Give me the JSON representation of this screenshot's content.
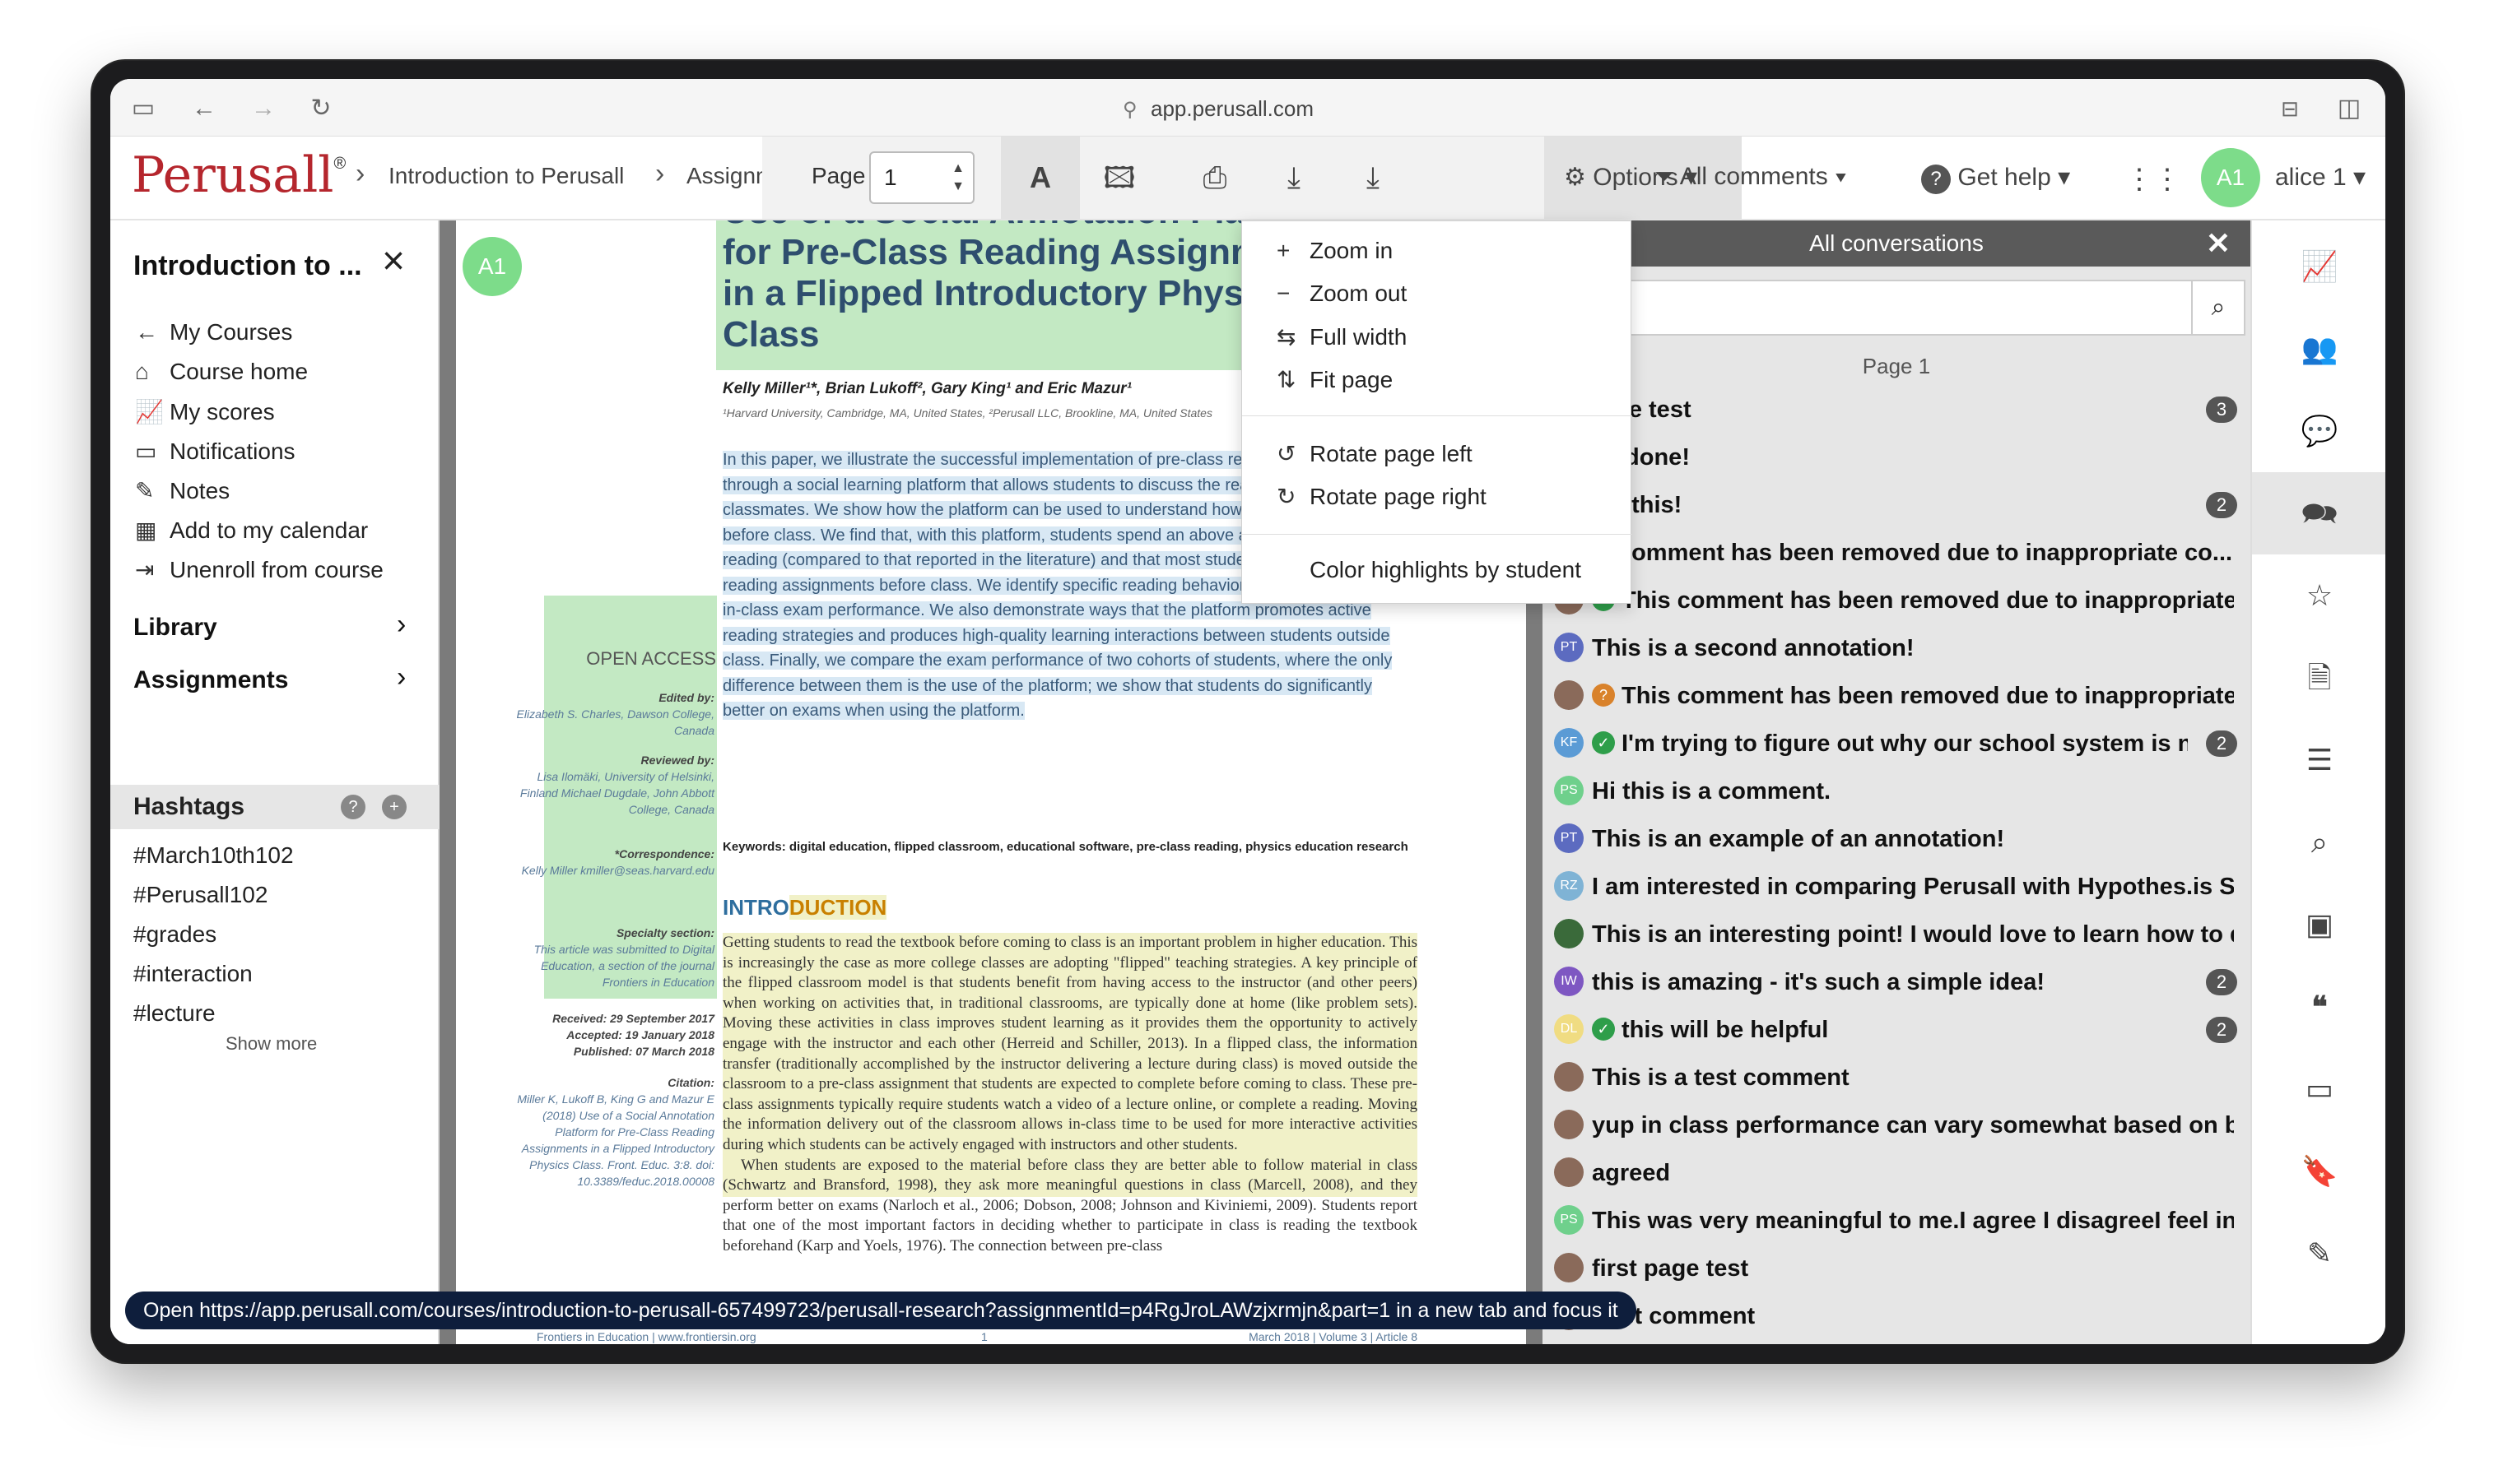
{
  "browser": {
    "url": "app.perusall.com"
  },
  "app": {
    "logo": "Perusall",
    "breadcrumb": [
      "Introduction to Perusall",
      "Assignm"
    ],
    "toolbar": {
      "page_label": "Page",
      "page_value": "1",
      "options_label": "Options ▾"
    },
    "all_comments_label": "All comments ▾",
    "get_help_label": "Get help ▾",
    "user_initials": "A1",
    "user_name": "alice 1 ▾"
  },
  "sidebar": {
    "title": "Introduction to ...",
    "items": [
      {
        "icon": "arrow-left-icon",
        "label": "My Courses"
      },
      {
        "icon": "home-icon",
        "label": "Course home"
      },
      {
        "icon": "chart-icon",
        "label": "My scores"
      },
      {
        "icon": "inbox-icon",
        "label": "Notifications"
      },
      {
        "icon": "pencil-icon",
        "label": "Notes"
      },
      {
        "icon": "calendar-icon",
        "label": "Add to my calendar"
      },
      {
        "icon": "exit-icon",
        "label": "Unenroll from course"
      }
    ],
    "library_label": "Library",
    "assignments_label": "Assignments",
    "hashtags_label": "Hashtags",
    "hashtags": [
      "#March10th102",
      "#Perusall102",
      "#grades",
      "#interaction",
      "#lecture"
    ],
    "show_more": "Show more"
  },
  "document": {
    "avatar": "A1",
    "title_lines": [
      "Use of a Social Annotation Platform",
      "for Pre-Class Reading Assignments",
      "in a Flipped Introductory Physics",
      "Class"
    ],
    "authors": "Kelly Miller¹*, Brian Lukoff², Gary King¹ and Eric Mazur¹",
    "affiliation": "¹Harvard University, Cambridge, MA, United States, ²Perusall LLC, Brookline, MA, United States",
    "abstract": "In this paper, we illustrate the successful implementation of pre-class reading assignments through a social learning platform that allows students to discuss the reading online with their classmates. We show how the platform can be used to understand how students are reading before class. We find that, with this platform, students spend an above average amount of time reading (compared to that reported in the literature) and that most students complete their reading assignments before class. We identify specific reading behaviors that are predictive of in-class exam performance. We also demonstrate ways that the platform promotes active reading strategies and produces high-quality learning interactions between students outside class. Finally, we compare the exam performance of two cohorts of students, where the only difference between them is the use of the platform; we show that students do significantly better on exams when using the platform.",
    "keywords": "Keywords: digital education, flipped classroom, educational software, pre-class reading, physics education research",
    "intro_heading_a": "INTRO",
    "intro_heading_b": "DUCTION",
    "body_p1": "Getting students to read the textbook before coming to class is an important problem in higher education. This is increasingly the case as more college classes are adopting \"flipped\" teaching strategies. A key principle of the flipped classroom model is that students benefit from having access to the instructor (and other peers) when working on activities that, in traditional classrooms, are typically done at home (like problem sets). Moving these activities in class improves student learning as it provides them the opportunity to actively engage with the instructor and each other (Herreid and Schiller, 2013). In a flipped class, the information transfer (traditionally accomplished by the instructor delivering a lecture during class) is moved outside the classroom to a pre-class assignment that students are expected to complete before coming to class. These pre-class assignments typically require students watch a video of a lecture online, or complete a reading. Moving the information delivery out of the classroom allows in-class time to be used for more interactive activities during which students can be actively engaged with instructors and other students.",
    "body_p2": "When students are exposed to the material before class they are better able to follow material in class (Schwartz and Bransford, 1998), they ask more meaningful questions in class (Marcell, 2008), and they perform better on exams (Narloch et al., 2006; Dobson, 2008; Johnson and Kiviniemi, 2009). Students report that one of the most important factors in deciding whether to participate in class is reading the textbook beforehand (Karp and Yoels, 1976). The connection between pre-class",
    "open_access": "OPEN ACCESS",
    "side": {
      "edited_by_label": "Edited by:",
      "edited_by": "Elizabeth S. Charles, Dawson College, Canada",
      "reviewed_by_label": "Reviewed by:",
      "reviewed_by": "Lisa Ilomäki, University of Helsinki, Finland Michael Dugdale, John Abbott College, Canada",
      "correspondence_label": "*Correspondence:",
      "correspondence": "Kelly Miller kmiller@seas.harvard.edu",
      "specialty_label": "Specialty section:",
      "specialty": "This article was submitted to Digital Education, a section of the journal Frontiers in Education",
      "received": "Received: 29 September 2017",
      "accepted": "Accepted: 19 January 2018",
      "published": "Published: 07 March 2018",
      "citation_label": "Citation:",
      "citation": "Miller K, Lukoff B, King G and Mazur E (2018) Use of a Social Annotation Platform for Pre-Class Reading Assignments in a Flipped Introductory Physics Class. Front. Educ. 3:8. doi: 10.3389/feduc.2018.00008"
    },
    "footer_left": "Frontiers in Education | www.frontiersin.org",
    "footer_center": "1",
    "footer_right": "March 2018 | Volume 3 | Article 8"
  },
  "options_menu": {
    "zoom_in": "Zoom in",
    "zoom_out": "Zoom out",
    "full_width": "Full width",
    "fit_page": "Fit page",
    "rotate_left": "Rotate page left",
    "rotate_right": "Rotate page right",
    "color_highlights": "Color highlights by student"
  },
  "conversations": {
    "header": "All conversations",
    "search_value": "h",
    "page_label": "Page 1",
    "items": [
      {
        "initials": "",
        "color": "#888888",
        "check": "",
        "text": "icture test",
        "count": "3"
      },
      {
        "initials": "",
        "color": "#888888",
        "check": "",
        "text": "Vell done!",
        "count": ""
      },
      {
        "initials": "",
        "color": "#888888",
        "check": "",
        "text": "love this!",
        "count": "2"
      },
      {
        "initials": "",
        "color": "#888888",
        "check": "",
        "text": "his comment has been removed due to inappropriate co...",
        "count": ""
      },
      {
        "initials": "",
        "color": "#8a6a5a",
        "check": "green",
        "text": "This comment has been removed due to inappropriate co...",
        "count": ""
      },
      {
        "initials": "PT",
        "color": "#5c6bc0",
        "check": "",
        "text": "This is a second annotation!",
        "count": ""
      },
      {
        "initials": "",
        "color": "#8a6a5a",
        "check": "orange",
        "text": "This comment has been removed due to inappropriate co...",
        "count": ""
      },
      {
        "initials": "KF",
        "color": "#5b9bd5",
        "check": "green",
        "text": "I'm trying to figure out why our school system is not us...",
        "count": "2"
      },
      {
        "initials": "PS",
        "color": "#6fd08c",
        "check": "",
        "text": "Hi this is a comment.",
        "count": ""
      },
      {
        "initials": "PT",
        "color": "#5c6bc0",
        "check": "",
        "text": "This is an example of an annotation!",
        "count": ""
      },
      {
        "initials": "RZ",
        "color": "#7fb3d5",
        "check": "",
        "text": "I am interested in comparing Perusall with Hypothes.is So fa...",
        "count": ""
      },
      {
        "initials": "",
        "color": "#3a6a3a",
        "check": "",
        "text": "This is an interesting point! I would love to learn how to do th...",
        "count": ""
      },
      {
        "initials": "IW",
        "color": "#7e57c2",
        "check": "",
        "text": "this is amazing - it's such a simple idea!",
        "count": "2"
      },
      {
        "initials": "DL",
        "color": "#f0dc82",
        "check": "green",
        "text": "this will be helpful",
        "count": "2"
      },
      {
        "initials": "",
        "color": "#8a6a5a",
        "check": "",
        "text": "This is a test comment",
        "count": ""
      },
      {
        "initials": "",
        "color": "#8a6a5a",
        "check": "",
        "text": "yup in class performance can vary somewhat based on blah",
        "count": ""
      },
      {
        "initials": "",
        "color": "#8a6a5a",
        "check": "",
        "text": "agreed",
        "count": ""
      },
      {
        "initials": "PS",
        "color": "#6fd08c",
        "check": "",
        "text": "This was very meaningful to me.I agree I disagreeI feel indiff...",
        "count": ""
      },
      {
        "initials": "",
        "color": "#8a6a5a",
        "check": "",
        "text": "first page test",
        "count": ""
      },
      {
        "initials": "",
        "color": "#8a6a5a",
        "check": "",
        "text": "post comment",
        "count": ""
      }
    ]
  },
  "rightbar_icons": [
    "chart-icon",
    "people-icon",
    "comment-icon",
    "conversations-icon",
    "star-icon",
    "document-icon",
    "list-icon",
    "search-icon",
    "contacts-icon",
    "quote-icon",
    "inbox-icon",
    "bookmark-icon",
    "pencil-icon"
  ],
  "statusbar": {
    "prefix": "Open ",
    "url": "https://app.perusall.com/courses/introduction-to-perusall-657499723/perusall-research?assignmentId=p4RgJroLAWzjxrmjn&part=1",
    "suffix": " in a new tab and focus it"
  }
}
